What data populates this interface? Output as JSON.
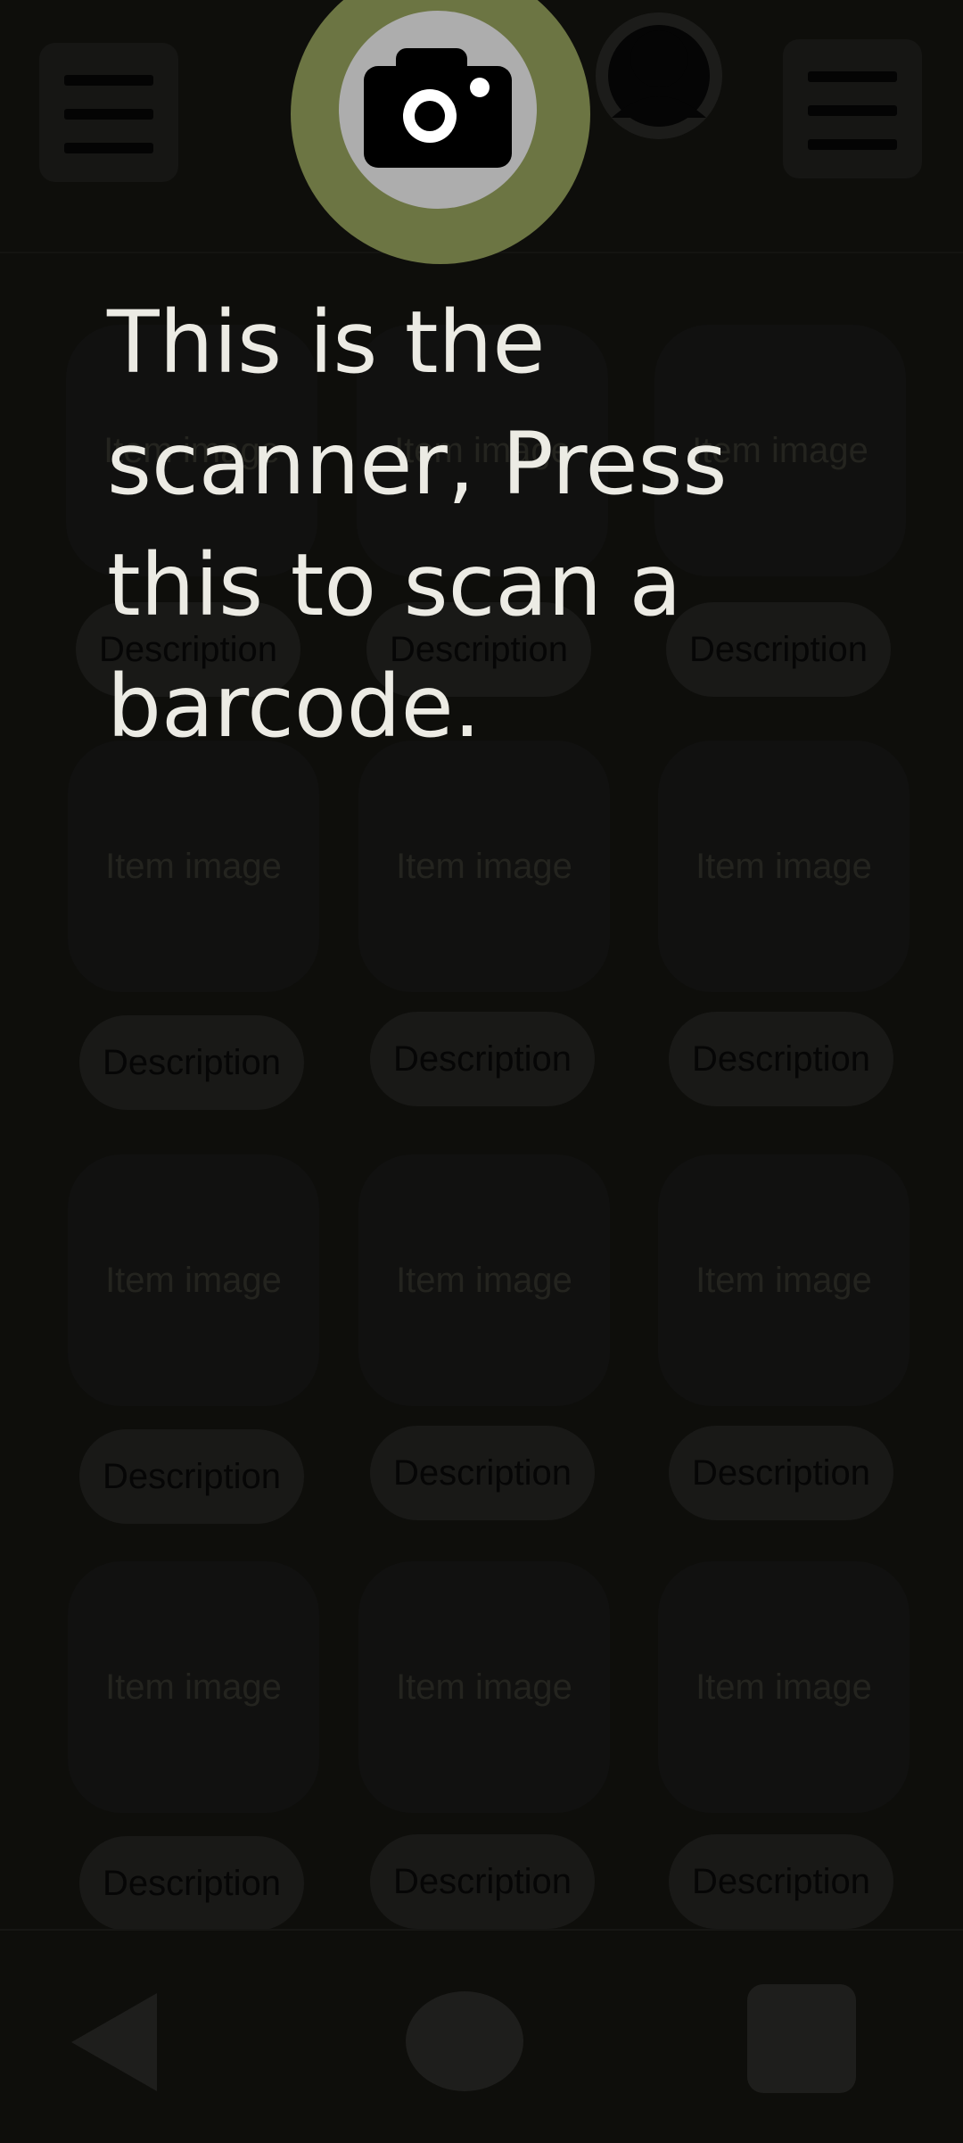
{
  "header": {
    "left_menu_icon": "hamburger-menu-icon",
    "right_menu_icon": "hamburger-menu-icon",
    "profile_icon": "user-avatar-icon"
  },
  "scanner": {
    "icon": "camera-icon",
    "spotlight_color": "#6c7543",
    "tooltip": "This is the scanner, Press this to scan a barcode."
  },
  "grid": {
    "rows": [
      {
        "items": [
          {
            "image": "Item image",
            "description": "Description"
          },
          {
            "image": "Item image",
            "description": "Description"
          },
          {
            "image": "Item image",
            "description": "Description"
          }
        ]
      },
      {
        "items": [
          {
            "image": "Item image",
            "description": "Description"
          },
          {
            "image": "Item image",
            "description": "Description"
          },
          {
            "image": "Item image",
            "description": "Description"
          }
        ]
      },
      {
        "items": [
          {
            "image": "Item image",
            "description": "Description"
          },
          {
            "image": "Item image",
            "description": "Description"
          },
          {
            "image": "Item image",
            "description": "Description"
          }
        ]
      },
      {
        "items": [
          {
            "image": "Item image",
            "description": "Description"
          },
          {
            "image": "Item image",
            "description": "Description"
          },
          {
            "image": "Item image",
            "description": "Description"
          }
        ]
      }
    ]
  },
  "navbar": {
    "back_icon": "back-triangle-icon",
    "home_icon": "home-circle-icon",
    "recents_icon": "recents-square-icon"
  }
}
